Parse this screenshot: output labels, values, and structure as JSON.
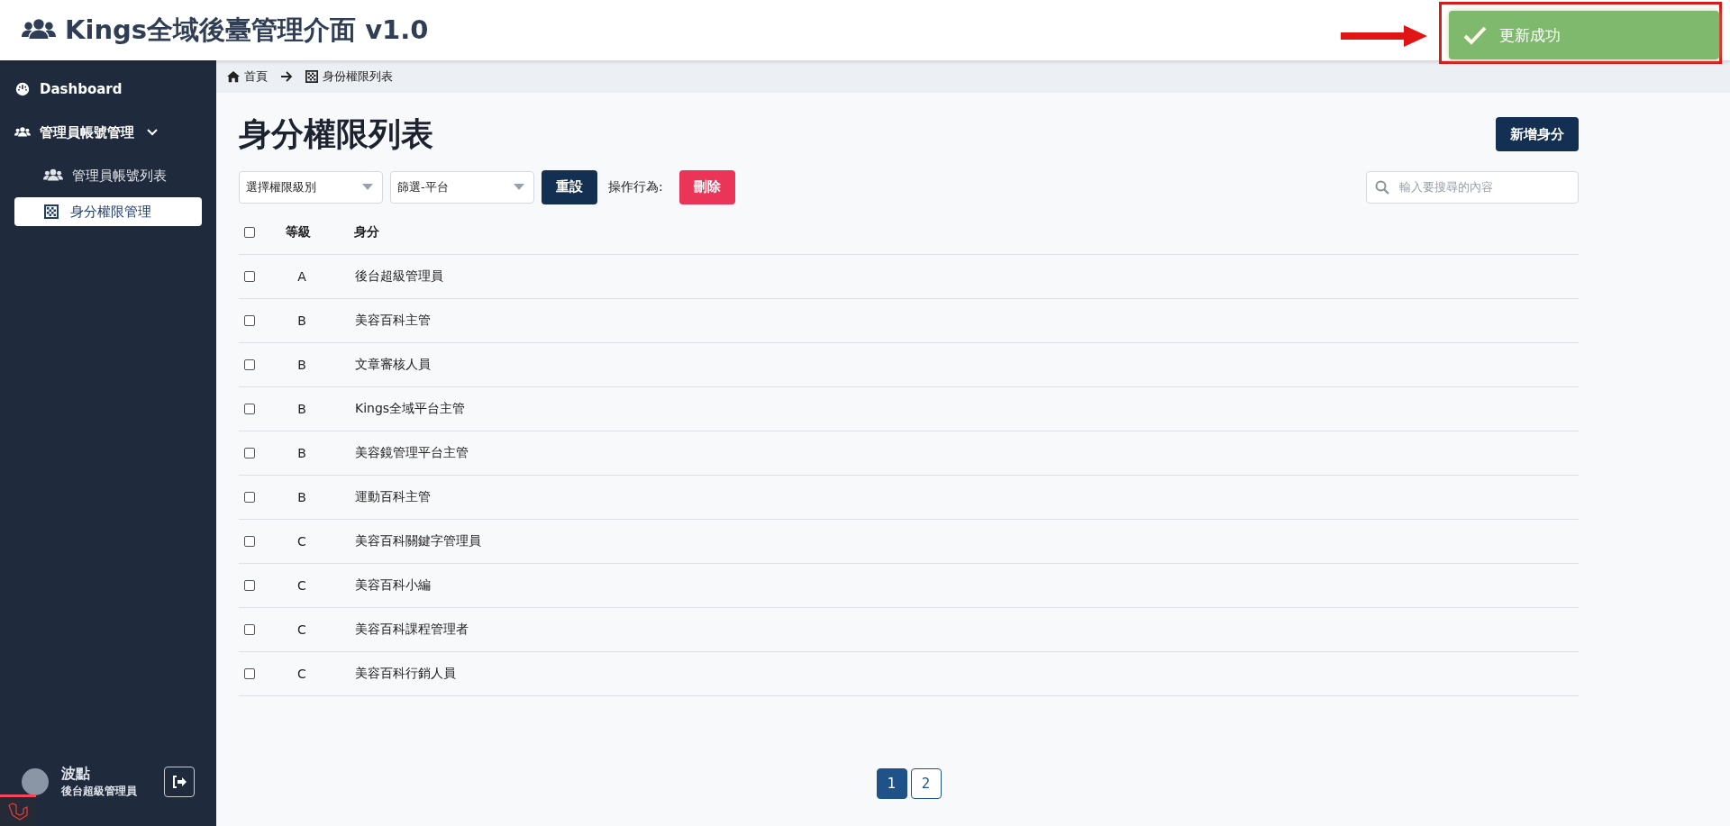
{
  "header": {
    "title": "Kings全域後臺管理介面 v1.0"
  },
  "toast": {
    "message": "更新成功"
  },
  "sidebar": {
    "items": [
      {
        "label": "Dashboard",
        "kind": "top",
        "selected": false
      },
      {
        "label": "管理員帳號管理",
        "kind": "group",
        "selected": false,
        "expanded": true,
        "children": [
          {
            "label": "管理員帳號列表",
            "kind": "sub",
            "selected": false
          },
          {
            "label": "身分權限管理",
            "kind": "sub",
            "selected": true
          }
        ]
      }
    ],
    "user": {
      "name": "波點",
      "role": "後台超級管理員"
    }
  },
  "breadcrumb": [
    {
      "label": "首頁"
    },
    {
      "label": "身份權限列表"
    }
  ],
  "page": {
    "title": "身分權限列表",
    "add_button": "新增身分"
  },
  "filters": {
    "selects": [
      {
        "value": "選擇權限級別"
      },
      {
        "value": "篩選-平台"
      }
    ],
    "reset_button": "重設",
    "action_label": "操作行為:",
    "delete_button": "刪除",
    "search": {
      "placeholder": "輸入要搜尋的內容"
    }
  },
  "table": {
    "select_all": {
      "checked": false
    },
    "columns": [
      "等級",
      "身分"
    ],
    "rows": [
      {
        "checked": false,
        "level": "A",
        "role": "後台超級管理員"
      },
      {
        "checked": false,
        "level": "B",
        "role": "美容百科主管"
      },
      {
        "checked": false,
        "level": "B",
        "role": "文章審核人員"
      },
      {
        "checked": false,
        "level": "B",
        "role": "Kings全域平台主管"
      },
      {
        "checked": false,
        "level": "B",
        "role": "美容鏡管理平台主管"
      },
      {
        "checked": false,
        "level": "B",
        "role": "運動百科主管"
      },
      {
        "checked": false,
        "level": "C",
        "role": "美容百科關鍵字管理員"
      },
      {
        "checked": false,
        "level": "C",
        "role": "美容百科小編"
      },
      {
        "checked": false,
        "level": "C",
        "role": "美容百科課程管理者"
      },
      {
        "checked": false,
        "level": "C",
        "role": "美容百科行銷人員"
      }
    ]
  },
  "pagination": [
    {
      "label": "1",
      "selected": true
    },
    {
      "label": "2",
      "selected": false
    }
  ]
}
